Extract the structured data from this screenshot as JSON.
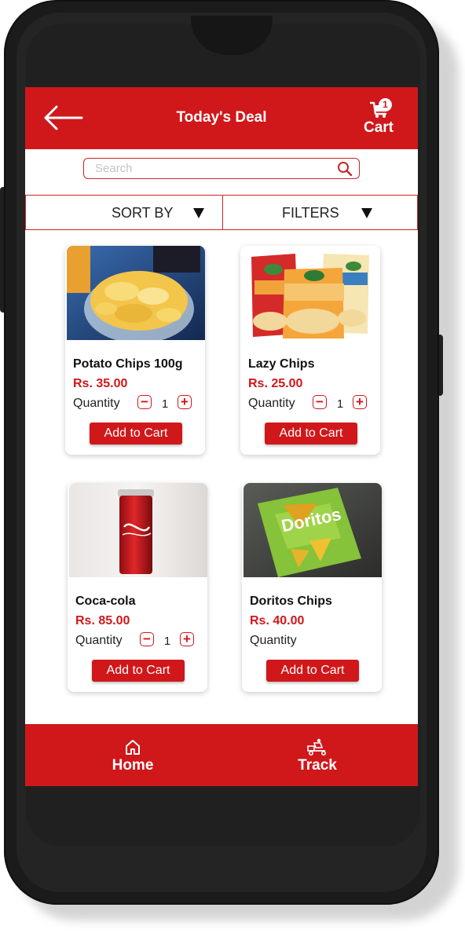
{
  "header": {
    "title": "Today's Deal",
    "back_icon": "arrow-left-icon",
    "cart_label": "Cart",
    "cart_count": "1",
    "cart_icon": "cart-icon"
  },
  "search": {
    "placeholder": "Search",
    "value": "",
    "icon": "search-icon"
  },
  "toolbar": {
    "sort_label": "SORT BY",
    "filter_label": "FILTERS"
  },
  "products": [
    {
      "name": "Potato Chips 100g",
      "price": "Rs. 35.00",
      "quantity_label": "Quantity",
      "quantity": "1",
      "add_label": "Add to Cart"
    },
    {
      "name": "Lazy Chips",
      "price": "Rs. 25.00",
      "quantity_label": "Quantity",
      "quantity": "1",
      "add_label": "Add to Cart"
    },
    {
      "name": "Coca-cola",
      "price": "Rs. 85.00",
      "quantity_label": "Quantity",
      "quantity": "1",
      "add_label": "Add to Cart"
    },
    {
      "name": "Doritos Chips",
      "price": "Rs. 40.00",
      "quantity_label": "Quantity",
      "quantity": "",
      "add_label": "Add to Cart"
    }
  ],
  "bottom_nav": {
    "home_label": "Home",
    "track_label": "Track",
    "home_icon": "home-icon",
    "track_icon": "delivery-icon"
  },
  "colors": {
    "brand_red": "#d0171a",
    "phone_frame": "#1b1b1b"
  }
}
